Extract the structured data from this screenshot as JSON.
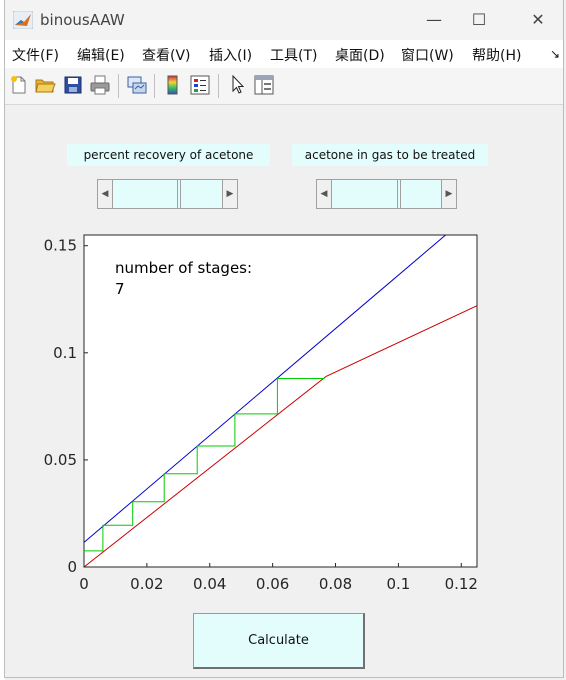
{
  "window": {
    "title": "binousAAW",
    "minimize_glyph": "—",
    "maximize_glyph": "☐",
    "close_glyph": "✕"
  },
  "menu": {
    "items": [
      "文件(F)",
      "编辑(E)",
      "查看(V)",
      "插入(I)",
      "工具(T)",
      "桌面(D)",
      "窗口(W)",
      "帮助(H)"
    ],
    "overflow_glyph": "↘"
  },
  "toolbar": {
    "icons": [
      "new-file-icon",
      "open-folder-icon",
      "save-icon",
      "print-icon",
      "link-plot-icon",
      "colorbar-icon",
      "legend-icon",
      "pointer-icon",
      "property-inspector-icon"
    ]
  },
  "controls": {
    "recovery_label": "percent recovery of acetone",
    "gas_label": "acetone in gas to be treated",
    "recovery_slider_value": 0.55,
    "gas_slider_value": 0.55,
    "calculate_label": "Calculate"
  },
  "chart_data": {
    "type": "line",
    "annotation": [
      "number of stages:",
      "7"
    ],
    "xlim": [
      0,
      0.125
    ],
    "ylim": [
      0,
      0.155
    ],
    "xticks": [
      0,
      0.02,
      0.04,
      0.06,
      0.08,
      0.1,
      0.12
    ],
    "xtick_labels": [
      "0",
      "0.02",
      "0.04",
      "0.06",
      "0.08",
      "0.1",
      "0.12"
    ],
    "yticks": [
      0,
      0.05,
      0.1,
      0.15
    ],
    "ytick_labels": [
      "0",
      "0.05",
      "0.1",
      "0.15"
    ],
    "grid": false,
    "series": [
      {
        "color": "#0000cc",
        "x": [
          0,
          0.115
        ],
        "y": [
          0.0115,
          0.155
        ]
      },
      {
        "color": "#cc0000",
        "x": [
          0,
          0.077,
          0.125
        ],
        "y": [
          0,
          0.089,
          0.122
        ]
      },
      {
        "color": "#00cc00",
        "x": [
          0,
          0.006,
          0.006,
          0.0155,
          0.0155,
          0.0255,
          0.0255,
          0.036,
          0.036,
          0.048,
          0.048,
          0.0615,
          0.0615,
          0.0765
        ],
        "y": [
          0.0075,
          0.0075,
          0.0195,
          0.0195,
          0.0305,
          0.0305,
          0.0435,
          0.0435,
          0.0565,
          0.0565,
          0.0715,
          0.0715,
          0.088,
          0.088
        ]
      }
    ]
  }
}
